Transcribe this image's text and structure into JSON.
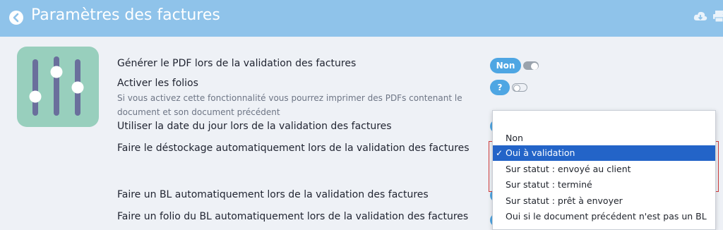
{
  "header": {
    "title": "Paramètres des factures",
    "bg_color": "#8fc3ea"
  },
  "settings": [
    {
      "label": "Générer le PDF lors de la validation des factures",
      "control": "Non"
    },
    {
      "label": "Activer les folios",
      "control": "?",
      "description_line1": "Si vous activez cette fonctionnalité vous pourrez imprimer des PDFs contenant le",
      "description_line2": "document et son document précédent"
    },
    {
      "label": "Utiliser la date du jour lors de la validation des factures"
    },
    {
      "label": "Faire le déstockage automatiquement lors de la validation des factures"
    },
    {
      "label": "Faire un BL automatiquement lors de la validation des factures"
    },
    {
      "label": "Faire un folio du BL automatiquement lors de la validation des factures"
    }
  ],
  "dropdown": {
    "check_mark": "✓",
    "options": [
      "Non",
      "Oui à validation",
      "Sur statut : envoyé au client",
      "Sur statut : terminé",
      "Sur statut : prêt à envoyer",
      "Oui si le document précédent n'est pas un BL"
    ],
    "selected": "Oui à validation"
  },
  "colors": {
    "accent": "#4ea6e3",
    "selection": "#2364c8",
    "icon_bg": "#98cfbd",
    "slider": "#6a6f9c"
  }
}
